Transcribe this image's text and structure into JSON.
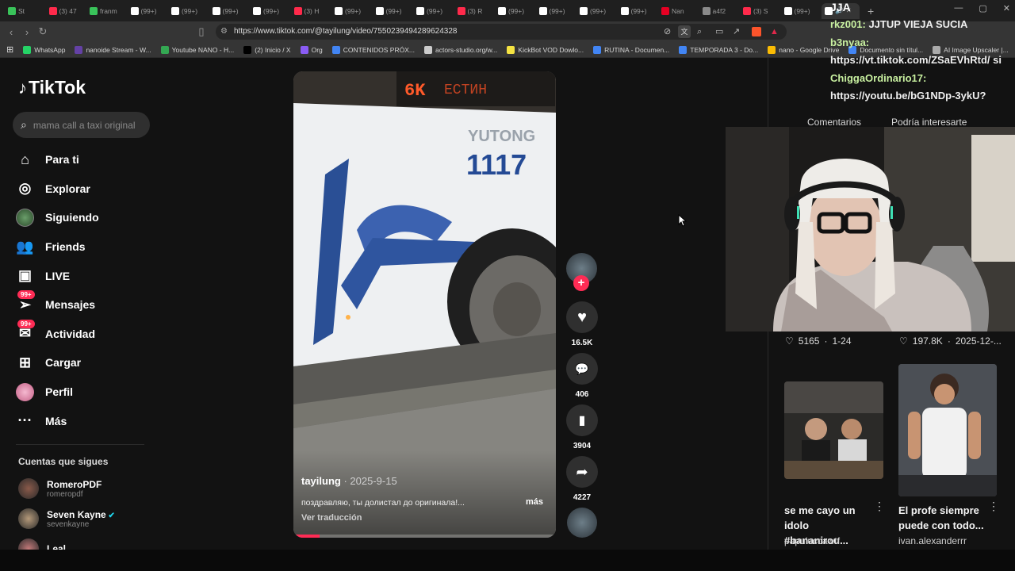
{
  "browser": {
    "tabs": [
      {
        "label": "St",
        "color": "#39c35a"
      },
      {
        "label": "(3) 47",
        "color": "#ff2a4b"
      },
      {
        "label": "franm",
        "color": "#39c35a"
      },
      {
        "label": "(99+)",
        "color": "#ffffff"
      },
      {
        "label": "(99+)",
        "color": "#ffffff"
      },
      {
        "label": "(99+)",
        "color": "#ffffff"
      },
      {
        "label": "(99+)",
        "color": "#ffffff"
      },
      {
        "label": "(3) H",
        "color": "#ff2a4b"
      },
      {
        "label": "(99+)",
        "color": "#ffffff"
      },
      {
        "label": "(99+)",
        "color": "#ffffff"
      },
      {
        "label": "(99+)",
        "color": "#ffffff"
      },
      {
        "label": "(3) R",
        "color": "#ff2a4b"
      },
      {
        "label": "(99+)",
        "color": "#ffffff"
      },
      {
        "label": "(99+)",
        "color": "#ffffff"
      },
      {
        "label": "(99+)",
        "color": "#ffffff"
      },
      {
        "label": "(99+)",
        "color": "#ffffff"
      },
      {
        "label": "Nan",
        "color": "#e60023"
      },
      {
        "label": "a4f2",
        "color": "#8a8a8a"
      },
      {
        "label": "(3) S",
        "color": "#ff2a4b"
      },
      {
        "label": "(99+)",
        "color": "#ffffff"
      }
    ],
    "url": "https://www.tiktok.com/@tayilung/video/7550239494289624328",
    "bookmarks": [
      {
        "label": "WhatsApp",
        "color": "#25d366"
      },
      {
        "label": "nanoide Stream - W...",
        "color": "#6441a5"
      },
      {
        "label": "Youtube NANO - H...",
        "color": "#34a853"
      },
      {
        "label": "(2) Inicio / X",
        "color": "#000000"
      },
      {
        "label": "Org",
        "color": "#8a5cf5"
      },
      {
        "label": "CONTENIDOS PRÓX...",
        "color": "#4285f4"
      },
      {
        "label": "actors-studio.org/w...",
        "color": "#cccccc"
      },
      {
        "label": "KickBot VOD Dowlo...",
        "color": "#f5e342"
      },
      {
        "label": "RUTINA - Documen...",
        "color": "#4285f4"
      },
      {
        "label": "TEMPORADA 3 - Do...",
        "color": "#4285f4"
      },
      {
        "label": "nano - Google Drive",
        "color": "#fbbc04"
      },
      {
        "label": "Documento sin títul...",
        "color": "#4285f4"
      },
      {
        "label": "AI Image Upscaler |...",
        "color": "#aaaaaa"
      }
    ]
  },
  "sidebar": {
    "logo": "TikTok",
    "search_placeholder": "mama call a taxi original",
    "nav": [
      {
        "label": "Para ti",
        "icon": "home-icon"
      },
      {
        "label": "Explorar",
        "icon": "compass-icon"
      },
      {
        "label": "Siguiendo",
        "icon": "following-avatar"
      },
      {
        "label": "Friends",
        "icon": "friends-icon"
      },
      {
        "label": "LIVE",
        "icon": "live-icon"
      },
      {
        "label": "Mensajes",
        "icon": "messages-icon",
        "badge": "99+"
      },
      {
        "label": "Actividad",
        "icon": "activity-icon",
        "badge": "99+"
      },
      {
        "label": "Cargar",
        "icon": "upload-icon"
      },
      {
        "label": "Perfil",
        "icon": "profile-avatar"
      },
      {
        "label": "Más",
        "icon": "more-icon"
      }
    ],
    "following_title": "Cuentas que sigues",
    "accounts": [
      {
        "name": "RomeroPDF",
        "handle": "romeropdf",
        "verified": false
      },
      {
        "name": "Seven Kayne",
        "handle": "sevenkayne",
        "verified": true
      },
      {
        "name": "Leal",
        "handle": "",
        "verified": false
      }
    ]
  },
  "video": {
    "author": "tayilung",
    "date": "2025-9-15",
    "caption": "поздравляю, ты долистал до оригинала!...",
    "more": "más",
    "translate": "Ver traducción",
    "bus_number": "1117",
    "bus_brand": "YUTONG",
    "progress": 0.1,
    "likes": "16.5K",
    "comments": "406",
    "saves": "3904",
    "shares": "4227"
  },
  "right_panel": {
    "tab_comments": "Comentarios",
    "tab_related": "Podría interesarte",
    "stats": [
      {
        "likes": "5165",
        "date": "1-24"
      },
      {
        "likes": "197.8K",
        "date": "2025-12-..."
      }
    ],
    "videos": [
      {
        "title": "se me cayo un idolo #bananirou...",
        "author": "papuluccawtf"
      },
      {
        "title": "El profe siempre puede con todo...",
        "author": "ivan.alexanderrr"
      }
    ]
  },
  "stream_overlay": {
    "header": "JJA",
    "chat": [
      {
        "user": "rkz001:",
        "msg": "JJTUP VIEJA SUCIA"
      },
      {
        "user": "b3nyaa:",
        "msg": "https://vt.tiktok.com/ZSaEVhRtd/ si"
      },
      {
        "user": "ChiggaOrdinario17:",
        "msg": "https://youtu.be/bG1NDp-3ykU?"
      }
    ]
  }
}
